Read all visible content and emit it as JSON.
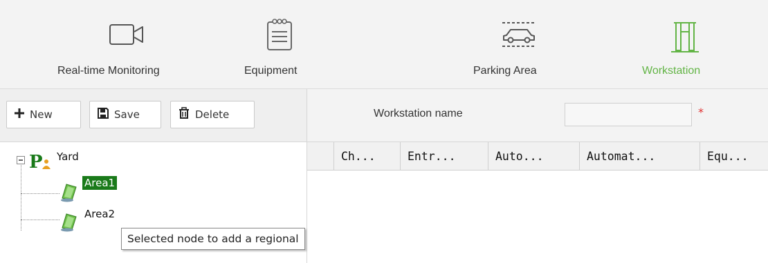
{
  "nav": {
    "items": [
      {
        "label": "Real-time Monitoring",
        "icon": "video-camera-icon"
      },
      {
        "label": "Equipment",
        "icon": "notepad-icon"
      },
      {
        "label": "Parking Area",
        "icon": "car-icon"
      },
      {
        "label": "Workstation",
        "icon": "gate-icon"
      }
    ],
    "active_color": "#62b445"
  },
  "toolbar": {
    "new_label": "New",
    "save_label": "Save",
    "delete_label": "Delete"
  },
  "form": {
    "workstation_name_label": "Workstation name",
    "workstation_name_value": "",
    "required_mark": "*"
  },
  "grid": {
    "columns": [
      "Ch...",
      "Entr...",
      "Auto...",
      "Automat...",
      "Equ..."
    ]
  },
  "tree": {
    "root": "Yard",
    "children": [
      "Area1",
      "Area2"
    ],
    "selected_color": "#1a7a1a"
  },
  "tooltip": {
    "text": "Selected node to add a regional"
  }
}
